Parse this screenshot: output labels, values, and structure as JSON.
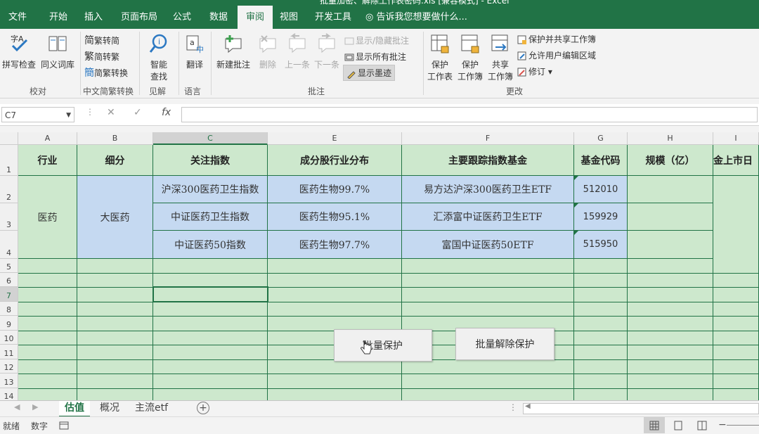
{
  "window": {
    "title": "批量加密、解除工作表密码.xls [兼容模式] - Excel"
  },
  "menu": {
    "items": [
      "文件",
      "开始",
      "插入",
      "页面布局",
      "公式",
      "数据",
      "审阅",
      "视图",
      "开发工具"
    ],
    "active": "审阅",
    "tell_me": "告诉我您想要做什么..."
  },
  "ribbon": {
    "proofing": {
      "spell": "拼写检查",
      "thesaurus": "同义词库",
      "group": "校对"
    },
    "chinese": {
      "to_trad": "繁转简",
      "to_simp": "简转繁",
      "convert": "简繁转换",
      "group": "中文简繁转换"
    },
    "insights": {
      "smart1": "智能",
      "smart2": "查找",
      "group": "见解"
    },
    "language": {
      "translate": "翻译",
      "group": "语言"
    },
    "comments": {
      "new": "新建批注",
      "delete": "删除",
      "prev": "上一条",
      "next": "下一条",
      "show_hide": "显示/隐藏批注",
      "show_all": "显示所有批注",
      "show_ink": "显示墨迹",
      "group": "批注"
    },
    "changes": {
      "protect_sheet_1": "保护",
      "protect_sheet_2": "工作表",
      "protect_wb_1": "保护",
      "protect_wb_2": "工作簿",
      "share_wb_1": "共享",
      "share_wb_2": "工作簿",
      "protect_share": "保护并共享工作簿",
      "allow_edit": "允许用户编辑区域",
      "track": "修订",
      "group": "更改"
    }
  },
  "formula_bar": {
    "name_box": "C7",
    "fx": "fx",
    "cancel": "✕",
    "enter": "✓",
    "value": ""
  },
  "columns": [
    "A",
    "B",
    "C",
    "E",
    "F",
    "G",
    "H",
    "I"
  ],
  "rows": [
    "1",
    "2",
    "3",
    "4",
    "5",
    "6",
    "7",
    "8",
    "9",
    "10",
    "11",
    "12",
    "13",
    "14"
  ],
  "table": {
    "headers": [
      "行业",
      "细分",
      "关注指数",
      "成分股行业分布",
      "主要跟踪指数基金",
      "基金代码",
      "规模（亿）",
      "金上市日"
    ],
    "industry": "医药",
    "segment": "大医药",
    "data": [
      {
        "index": "沪深300医药卫生指数",
        "dist": "医药生物99.7%",
        "fund": "易方达沪深300医药卫生ETF",
        "code": "512010"
      },
      {
        "index": "中证医药卫生指数",
        "dist": "医药生物95.1%",
        "fund": "汇添富中证医药卫生ETF",
        "code": "159929"
      },
      {
        "index": "中证医药50指数",
        "dist": "医药生物97.7%",
        "fund": "富国中证医药50ETF",
        "code": "515950"
      }
    ]
  },
  "buttons": {
    "protect": "批量保护",
    "unprotect": "批量解除保护"
  },
  "sheets": {
    "tabs": [
      "估值",
      "概况",
      "主流etf"
    ],
    "active": "估值"
  },
  "status": {
    "ready": "就绪",
    "mode": "数字"
  },
  "colors": {
    "brand": "#217346",
    "cell_green": "#cde8cd",
    "cell_blue": "#c5d9f1"
  }
}
